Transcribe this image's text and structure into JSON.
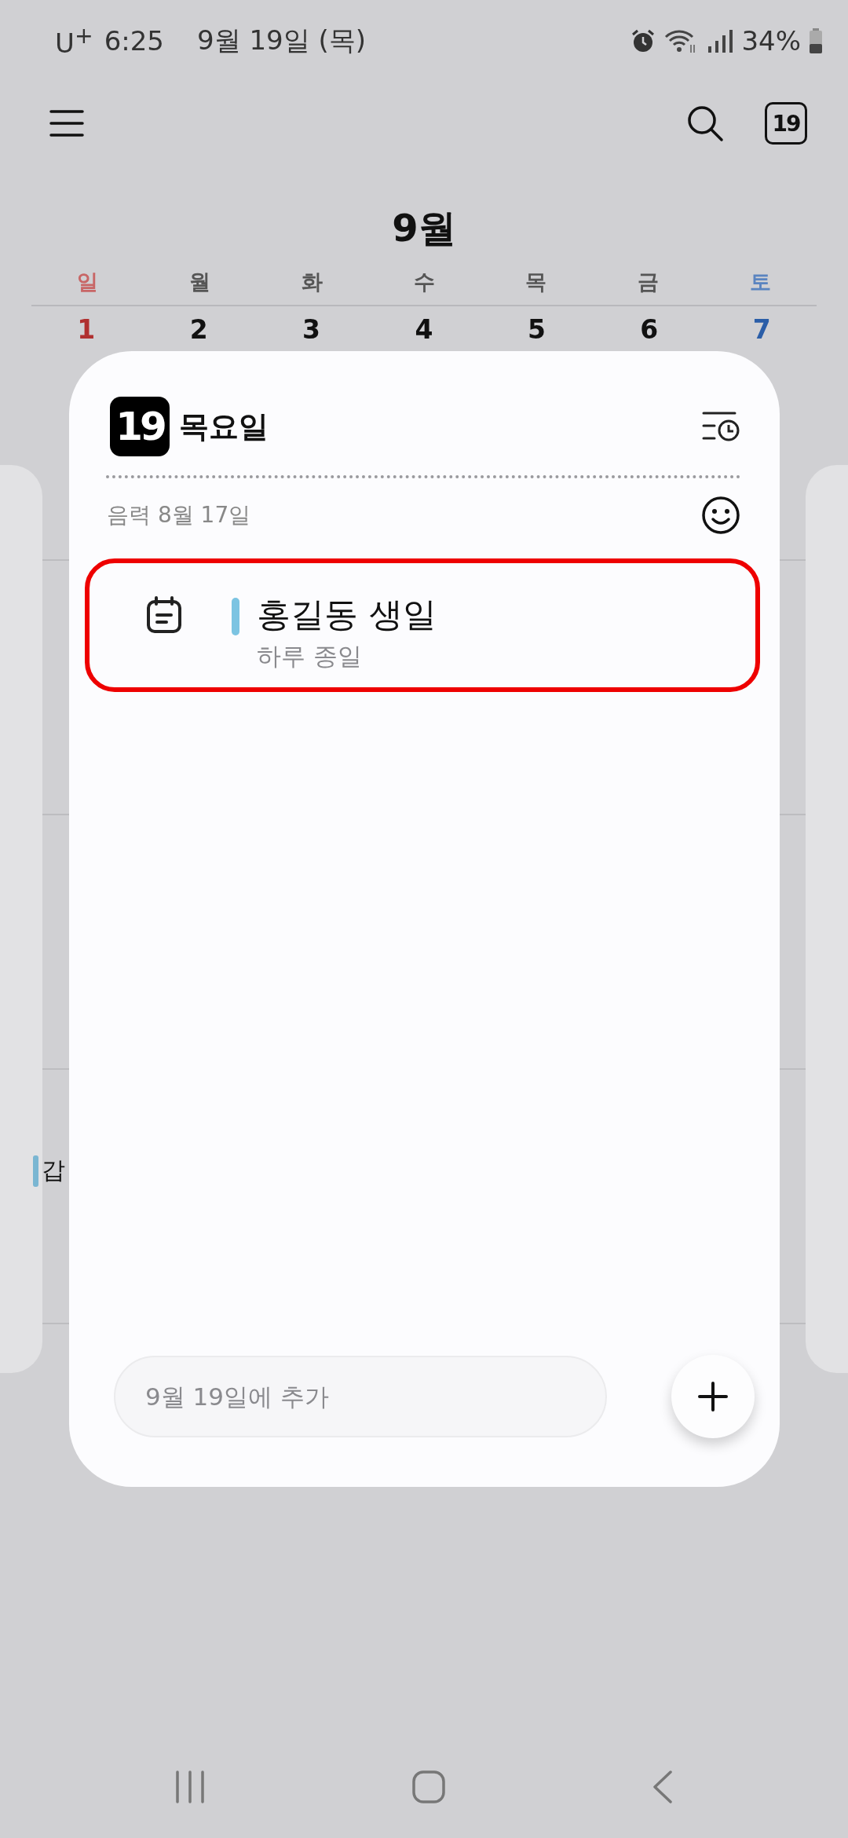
{
  "status_bar": {
    "carrier": "U$^{+}$",
    "time": "6:25",
    "date": "9월 19일 (목)",
    "battery": "34%"
  },
  "toolbar": {
    "today_badge": "19"
  },
  "calendar": {
    "month": "9월",
    "weekdays": [
      {
        "label": "일",
        "kind": "sunday"
      },
      {
        "label": "월",
        "kind": "weekday"
      },
      {
        "label": "화",
        "kind": "weekday"
      },
      {
        "label": "수",
        "kind": "weekday"
      },
      {
        "label": "목",
        "kind": "weekday"
      },
      {
        "label": "금",
        "kind": "weekday"
      },
      {
        "label": "토",
        "kind": "saturday"
      }
    ],
    "dates": [
      {
        "label": "1",
        "kind": "sunday"
      },
      {
        "label": "2",
        "kind": "weekday"
      },
      {
        "label": "3",
        "kind": "weekday"
      },
      {
        "label": "4",
        "kind": "weekday"
      },
      {
        "label": "5",
        "kind": "weekday"
      },
      {
        "label": "6",
        "kind": "weekday"
      },
      {
        "label": "7",
        "kind": "saturday"
      }
    ],
    "background_event": {
      "text": "갑",
      "color": "#7ab6d2"
    }
  },
  "day_sheet": {
    "day_number": "19",
    "weekday": "목요일",
    "lunar_date": "음력 8월 17일",
    "events": [
      {
        "title": "홍길동 생일",
        "time": "하루 종일",
        "color": "#7cc4e2",
        "highlighted": true
      }
    ],
    "add_field": {
      "placeholder": "9월 19일에 추가"
    }
  }
}
